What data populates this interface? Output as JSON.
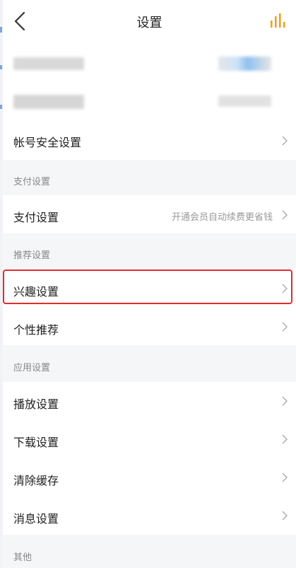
{
  "header": {
    "title": "设置",
    "back_icon": "chevron-left-icon",
    "stats_icon": "bar-chart-icon",
    "accent": "#f0a020"
  },
  "account_rows_blurred": true,
  "rows": {
    "account_security": "帐号安全设置",
    "payment": "支付设置",
    "payment_hint": "开通会员自动续费更省钱",
    "interests": "兴趣设置",
    "personal_recommend": "个性推荐",
    "playback": "播放设置",
    "download": "下载设置",
    "clear_cache": "清除缓存",
    "messages": "消息设置"
  },
  "sections": {
    "payment": "支付设置",
    "recommend": "推荐设置",
    "app": "应用设置",
    "other": "其他"
  },
  "highlight_color": "#e42b2b"
}
